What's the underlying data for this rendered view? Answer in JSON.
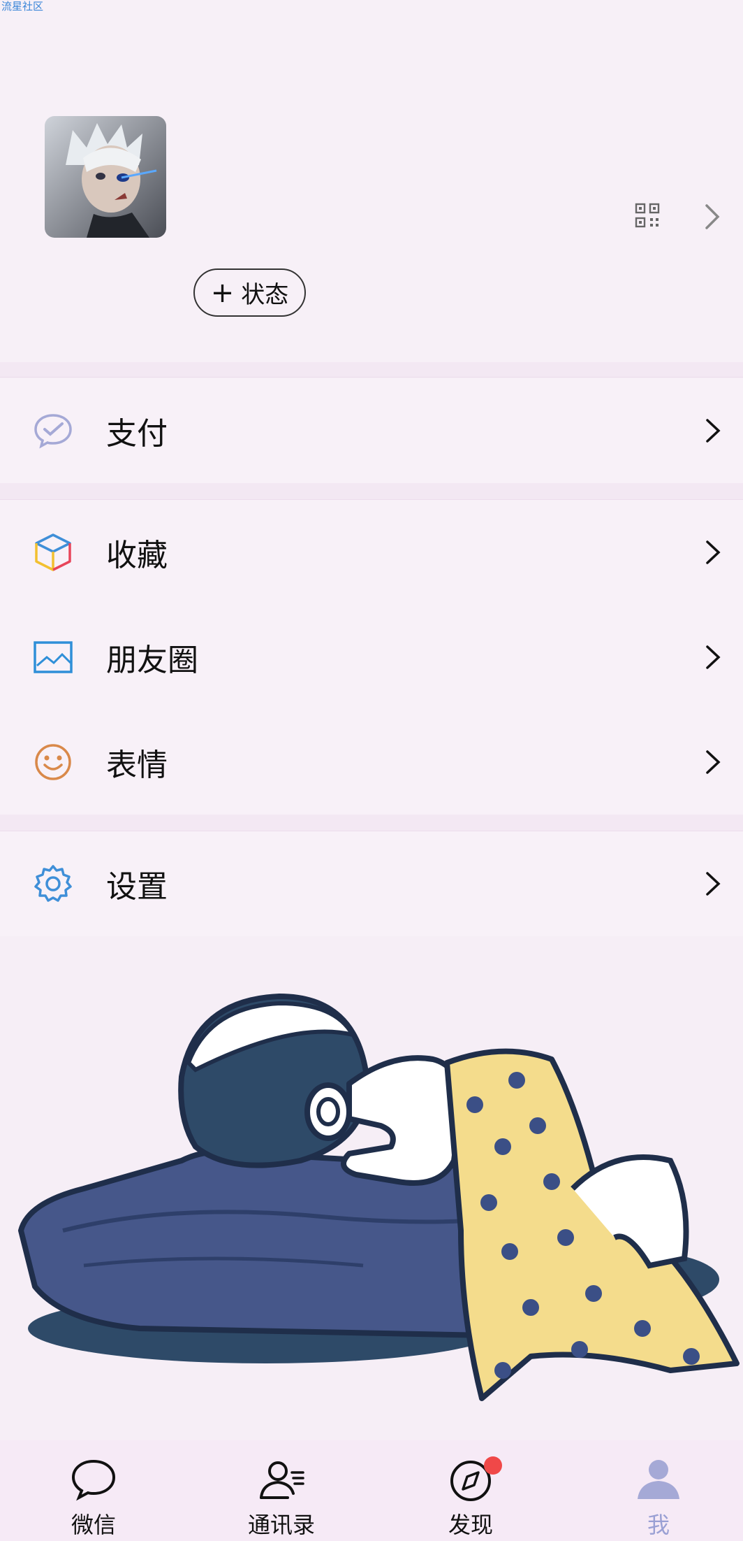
{
  "watermark": "流星社区",
  "profile": {
    "status_button": "状态"
  },
  "menu": {
    "pay": "支付",
    "favorites": "收藏",
    "moments": "朋友圈",
    "stickers": "表情",
    "settings": "设置"
  },
  "tabbar": {
    "tabs": [
      {
        "label": "微信",
        "icon": "chat-bubble-icon"
      },
      {
        "label": "通讯录",
        "icon": "contacts-icon"
      },
      {
        "label": "发现",
        "icon": "compass-icon"
      },
      {
        "label": "我",
        "icon": "person-icon"
      }
    ],
    "active_index": 3
  },
  "colors": {
    "background": "#f6eef6",
    "active_tab": "#9aa0d4",
    "badge": "#f04848"
  }
}
